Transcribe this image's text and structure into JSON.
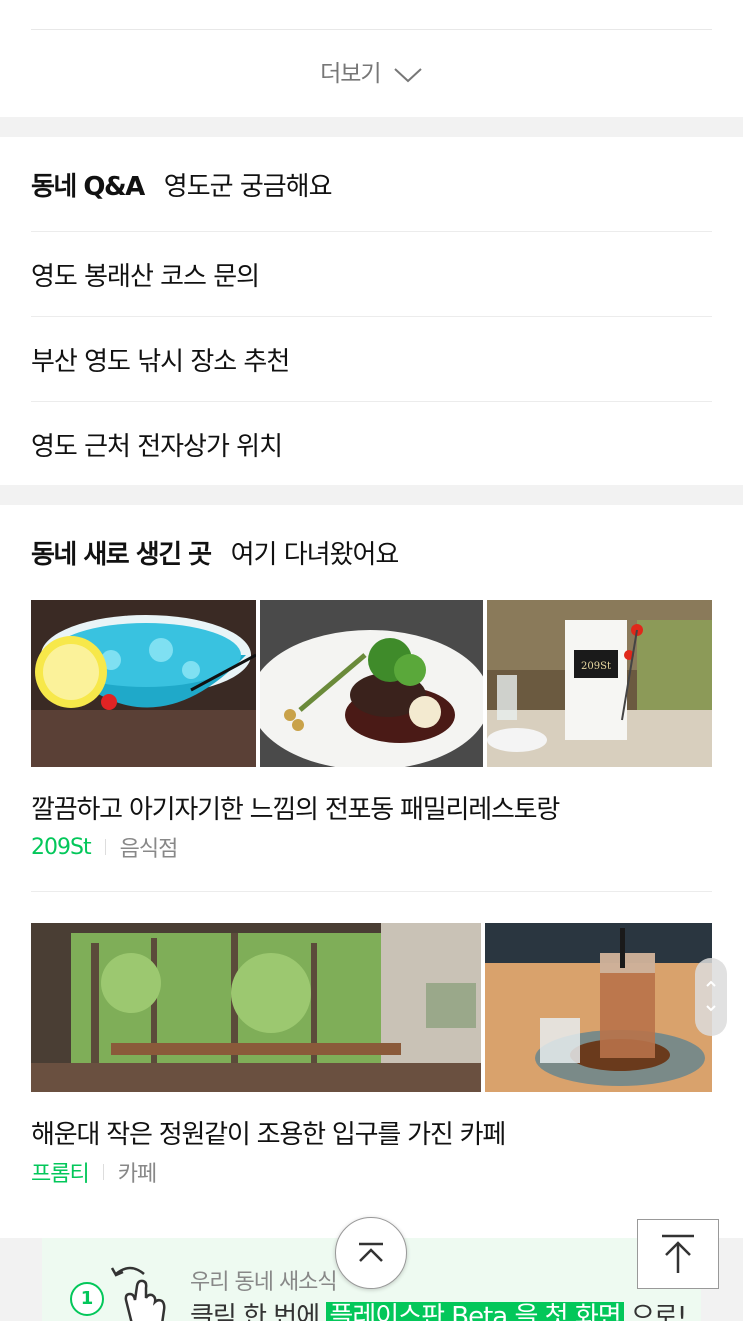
{
  "more": {
    "label": "더보기"
  },
  "qa": {
    "title": "동네 Q&A",
    "subtitle": "영도군 궁금해요",
    "items": [
      {
        "label": "영도 봉래산 코스 문의"
      },
      {
        "label": "부산 영도 낚시 장소 추천"
      },
      {
        "label": "영도 근처 전자상가 위치"
      }
    ]
  },
  "new_places": {
    "title": "동네 새로 생긴 곳",
    "subtitle": "여기 다녀왔어요",
    "cards": [
      {
        "title": "깔끔하고 아기자기한 느낌의 전포동 패밀리레스토랑",
        "name": "209St",
        "category": "음식점",
        "photos": [
          "blue cocktail",
          "steak plate",
          "table with menu 209St"
        ]
      },
      {
        "title": "해운대 작은 정원같이 조용한 입구를 가진 카페",
        "name": "프롬티",
        "category": "카페",
        "photos": [
          "cafe interior with bamboo garden window",
          "iced coffee drink"
        ]
      }
    ]
  },
  "banner": {
    "step": "1",
    "line1": "우리 동네 새소식",
    "line2_prefix": "클릭 한 번에 ",
    "line2_highlight": "플레이스판 Beta 을 첫 화면",
    "line2_suffix": " 으로!"
  },
  "menu_sign_text": "209St",
  "colors": {
    "accent": "#03c75a",
    "gap": "#f2f2f2",
    "divider": "#ececec"
  },
  "icons": [
    "chevron-down-icon",
    "double-chevron-up-icon",
    "arrow-to-top-icon",
    "hand-tap-icon"
  ]
}
